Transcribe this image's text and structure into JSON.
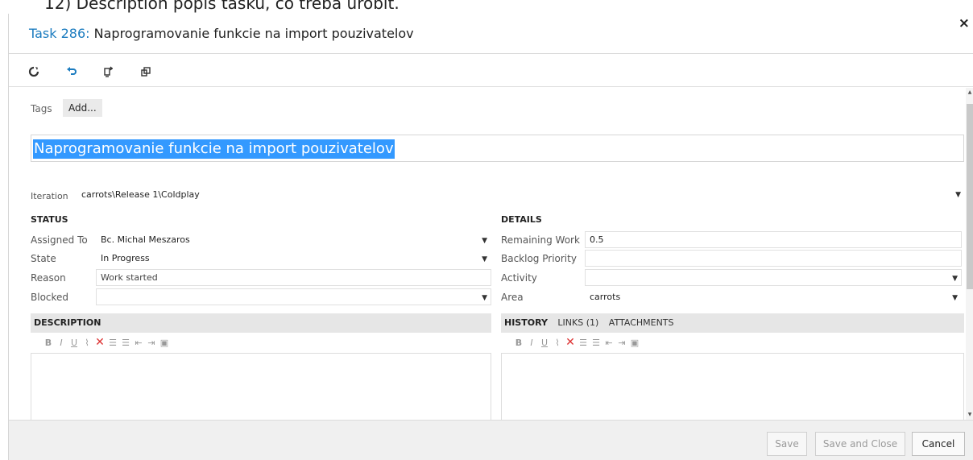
{
  "background": {
    "partial_text": "12) Description popis tasku, co treba urobit."
  },
  "dialog": {
    "title_prefix": "Task 286:",
    "title_text": "Naprogramovanie funkcie na import pouzivatelov",
    "close_glyph": "×"
  },
  "toolbar": {
    "icons": [
      "refresh-icon",
      "undo-icon",
      "copy-template-icon",
      "open-new-window-icon"
    ]
  },
  "tags": {
    "label": "Tags",
    "add_label": "Add..."
  },
  "title_field": {
    "value": "Naprogramovanie funkcie na import pouzivatelov"
  },
  "iteration": {
    "label": "Iteration",
    "value": "carrots\\Release 1\\Coldplay"
  },
  "status": {
    "header": "STATUS",
    "assigned_to": {
      "label": "Assigned To",
      "value": "Bc. Michal Meszaros"
    },
    "state": {
      "label": "State",
      "value": "In Progress"
    },
    "reason": {
      "label": "Reason",
      "value": "Work started"
    },
    "blocked": {
      "label": "Blocked",
      "value": ""
    }
  },
  "details": {
    "header": "DETAILS",
    "remaining_work": {
      "label": "Remaining Work",
      "value": "0.5"
    },
    "backlog_priority": {
      "label": "Backlog Priority",
      "value": ""
    },
    "activity": {
      "label": "Activity",
      "value": ""
    },
    "area": {
      "label": "Area",
      "value": "carrots"
    }
  },
  "description": {
    "header": "DESCRIPTION"
  },
  "history_panel": {
    "history_tab": "HISTORY",
    "links_tab": "LINKS (1)",
    "attachments_tab": "ATTACHMENTS"
  },
  "rte_toolbar": {
    "bold": "B",
    "italic": "I",
    "underline": "U",
    "delete_glyph": "✕"
  },
  "footer": {
    "save_label": "Save",
    "save_close_label": "Save and Close",
    "cancel_label": "Cancel"
  },
  "colors": {
    "accent": "#1a7bbf",
    "selection": "#3399ff",
    "panel_header": "#e6e6e6",
    "footer_bg": "#f0f0f0"
  }
}
